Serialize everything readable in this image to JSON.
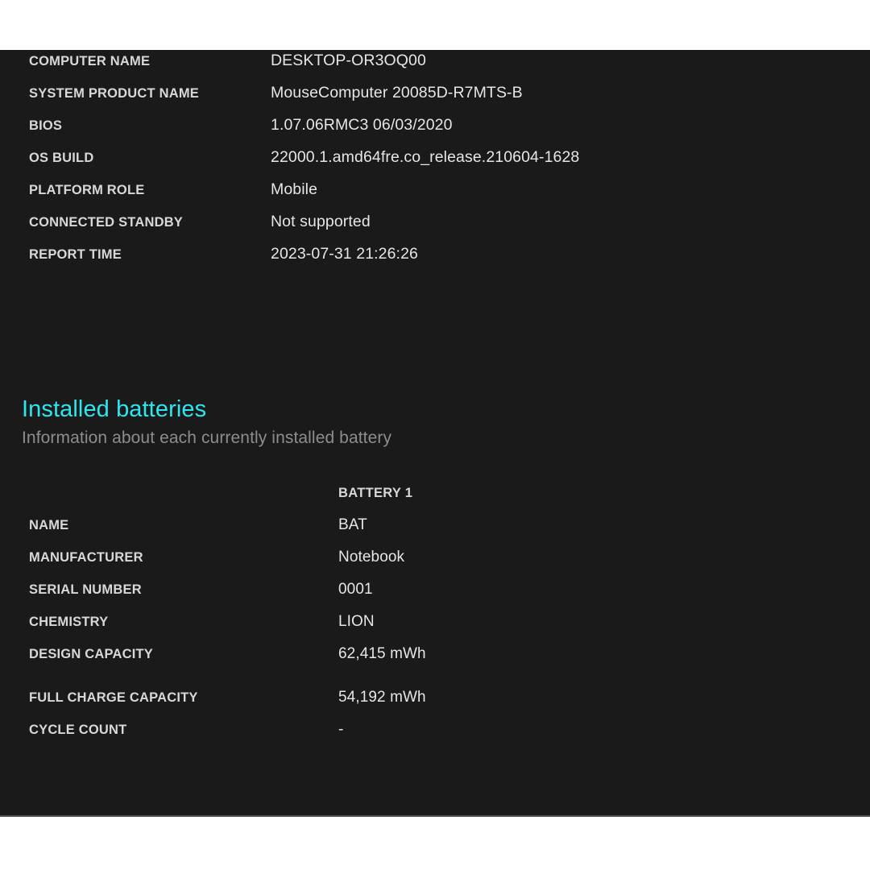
{
  "page": {
    "background_color": "#1a1a1a",
    "accent_color": "#2ee6ef",
    "label_color": "#d6d8da",
    "value_color": "#e4e6e8",
    "subtitle_color": "#8b8e91"
  },
  "system_summary": {
    "rows": [
      {
        "label": "COMPUTER NAME",
        "value": "DESKTOP-OR3OQ00"
      },
      {
        "label": "SYSTEM PRODUCT NAME",
        "value": "MouseComputer 20085D-R7MTS-B"
      },
      {
        "label": "BIOS",
        "value": "1.07.06RMC3 06/03/2020"
      },
      {
        "label": "OS BUILD",
        "value": "22000.1.amd64fre.co_release.210604-1628"
      },
      {
        "label": "PLATFORM ROLE",
        "value": "Mobile"
      },
      {
        "label": "CONNECTED STANDBY",
        "value": "Not supported"
      },
      {
        "label": "REPORT TIME",
        "value": "2023-07-31  21:26:26"
      }
    ]
  },
  "installed_batteries": {
    "title": "Installed batteries",
    "subtitle": "Information about each currently installed battery",
    "column_header": "BATTERY 1",
    "rows": [
      {
        "label": "NAME",
        "value": "BAT"
      },
      {
        "label": "MANUFACTURER",
        "value": "Notebook"
      },
      {
        "label": "SERIAL NUMBER",
        "value": "0001"
      },
      {
        "label": "CHEMISTRY",
        "value": "LION"
      },
      {
        "label": "DESIGN CAPACITY",
        "value": "62,415 mWh"
      },
      {
        "label": "FULL CHARGE CAPACITY",
        "value": "54,192 mWh"
      },
      {
        "label": "CYCLE COUNT",
        "value": "-"
      }
    ]
  }
}
